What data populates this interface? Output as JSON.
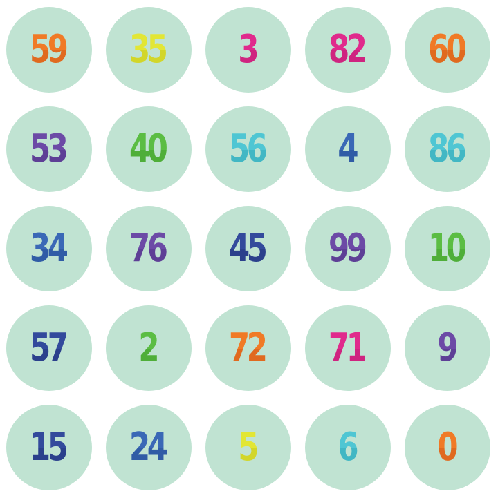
{
  "background_color": "#ffffff",
  "tile_color": "#c0e3d2",
  "tiles": [
    {
      "label": "59",
      "color": "#f07a26",
      "shade": "#e06a1f"
    },
    {
      "label": "35",
      "color": "#e2e635",
      "shade": "#d2d62a"
    },
    {
      "label": "3",
      "color": "#e02a8c",
      "shade": "#cf2480"
    },
    {
      "label": "82",
      "color": "#e02a8c",
      "shade": "#cf2480"
    },
    {
      "label": "60",
      "color": "#f07a26",
      "shade": "#e06a1f"
    },
    {
      "label": "53",
      "color": "#6c4aa6",
      "shade": "#5e3f96"
    },
    {
      "label": "40",
      "color": "#5bbd43",
      "shade": "#4fae39"
    },
    {
      "label": "56",
      "color": "#4fc6d3",
      "shade": "#42b7c4"
    },
    {
      "label": "4",
      "color": "#3a68b6",
      "shade": "#305ca6"
    },
    {
      "label": "86",
      "color": "#4fc6d3",
      "shade": "#42b7c4"
    },
    {
      "label": "34",
      "color": "#3a68b6",
      "shade": "#305ca6"
    },
    {
      "label": "76",
      "color": "#6c4aa6",
      "shade": "#5e3f96"
    },
    {
      "label": "45",
      "color": "#334a9c",
      "shade": "#2b408c"
    },
    {
      "label": "99",
      "color": "#6c4aa6",
      "shade": "#5e3f96"
    },
    {
      "label": "10",
      "color": "#5bbd43",
      "shade": "#4fae39"
    },
    {
      "label": "57",
      "color": "#334a9c",
      "shade": "#2b408c"
    },
    {
      "label": "2",
      "color": "#5bbd43",
      "shade": "#4fae39"
    },
    {
      "label": "72",
      "color": "#f07a26",
      "shade": "#e06a1f"
    },
    {
      "label": "71",
      "color": "#e02a8c",
      "shade": "#cf2480"
    },
    {
      "label": "9",
      "color": "#6c4aa6",
      "shade": "#5e3f96"
    },
    {
      "label": "15",
      "color": "#334a9c",
      "shade": "#2b408c"
    },
    {
      "label": "24",
      "color": "#3a68b6",
      "shade": "#305ca6"
    },
    {
      "label": "5",
      "color": "#e2e635",
      "shade": "#d2d62a"
    },
    {
      "label": "6",
      "color": "#4fc6d3",
      "shade": "#42b7c4"
    },
    {
      "label": "0",
      "color": "#f07a26",
      "shade": "#e06a1f"
    }
  ]
}
